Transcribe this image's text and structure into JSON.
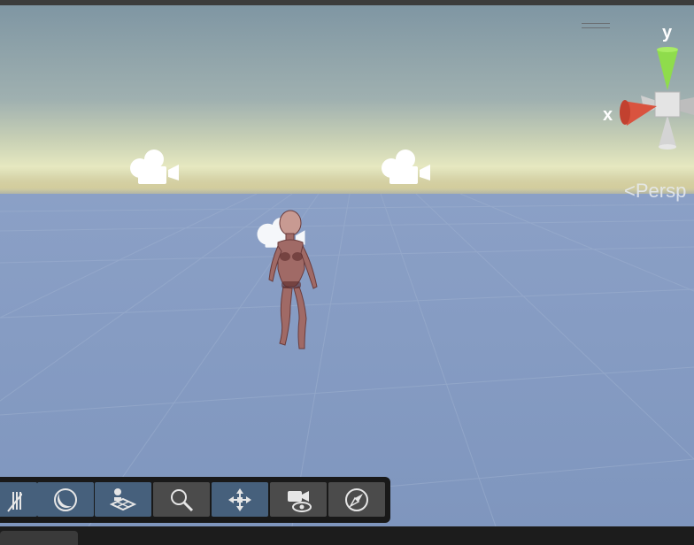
{
  "viewport": {
    "projection_label": "Persp",
    "axis_labels": {
      "x": "x",
      "y": "y"
    },
    "colors": {
      "x_axis": "#d9533f",
      "y_axis": "#8fdc4c",
      "z_axis": "#4a6fd8",
      "toolbar_active": "#46607c",
      "toolbar_inactive": "#4b4b4b"
    }
  },
  "overlay_toolbar": {
    "buttons": [
      {
        "icon": "grid-snap-icon",
        "active": true
      },
      {
        "icon": "shading-sphere-icon",
        "active": true
      },
      {
        "icon": "scene-view-layers-icon",
        "active": true
      },
      {
        "icon": "zoom-magnifier-icon",
        "active": false
      },
      {
        "icon": "move-tool-icon",
        "active": true
      },
      {
        "icon": "camera-visibility-icon",
        "active": false
      },
      {
        "icon": "compass-navigation-icon",
        "active": false
      }
    ]
  }
}
